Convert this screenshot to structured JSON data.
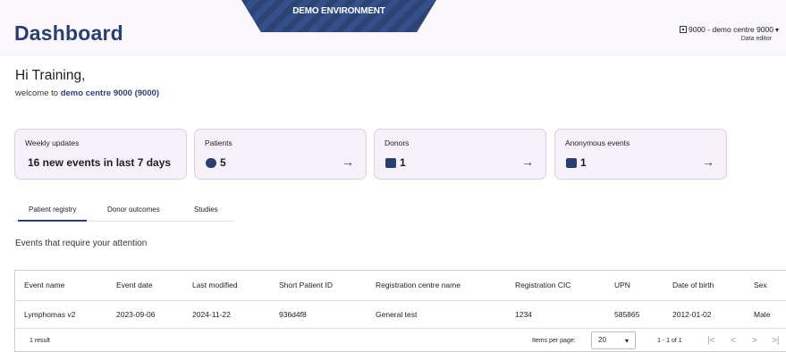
{
  "header": {
    "title": "Dashboard",
    "banner": "DEMO ENVIRONMENT",
    "centre_name": "9000 - demo centre 9000",
    "role": "Data editor"
  },
  "greeting": {
    "hello": "Hi Training,",
    "welcome_prefix": "welcome to",
    "centre": "demo centre 9000 (9000)"
  },
  "cards": [
    {
      "label": "Weekly updates",
      "value": "16 new events in last 7 days"
    },
    {
      "label": "Patients",
      "value": "5",
      "icon": "person-icon"
    },
    {
      "label": "Donors",
      "value": "1",
      "icon": "donor-card-icon"
    },
    {
      "label": "Anonymous events",
      "value": "1",
      "icon": "medical-kit-icon"
    }
  ],
  "tabs": [
    "Patient registry",
    "Donor outcomes",
    "Studies"
  ],
  "section_title": "Events that require your attention",
  "table": {
    "columns": [
      "Event name",
      "Event date",
      "Last modified",
      "Short Patient ID",
      "Registration centre name",
      "Registration CIC",
      "UPN",
      "Date of birth",
      "Sex"
    ],
    "rows": [
      [
        "Lymphomas v2",
        "2023-09-06",
        "2024-11-22",
        "936d4f8",
        "General test",
        "1234",
        "585865",
        "2012-01-02",
        "Male"
      ]
    ]
  },
  "pagination": {
    "result_count": "1 result",
    "items_per_page_label": "Items per page:",
    "items_per_page": "20",
    "range": "1 - 1 of 1"
  },
  "colors": {
    "brand": "#2a3f6f",
    "card_bg": "#f6f0f8",
    "header_bg": "#faf7fb"
  }
}
